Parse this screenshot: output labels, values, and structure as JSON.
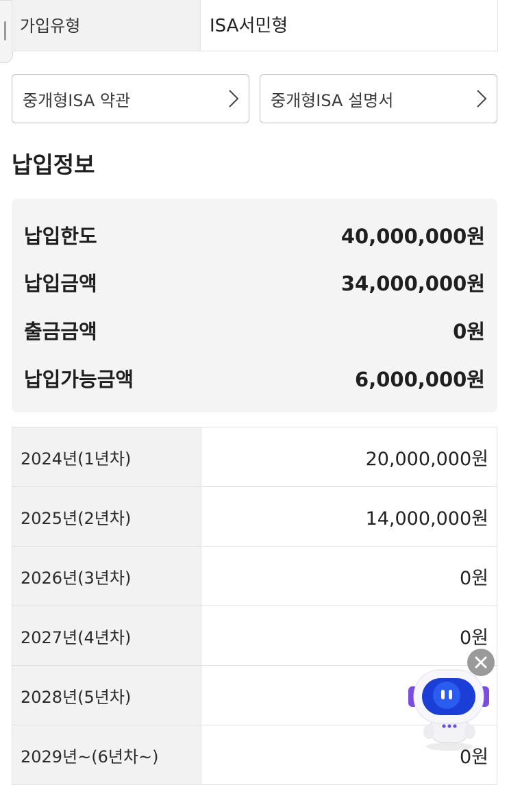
{
  "join_type": {
    "label": "가입유형",
    "value": "ISA서민형"
  },
  "docs": [
    {
      "label": "중개형ISA 약관"
    },
    {
      "label": "중개형ISA 설명서"
    }
  ],
  "payment_section_title": "납입정보",
  "summary": [
    {
      "label": "납입한도",
      "value": "40,000,000원"
    },
    {
      "label": "납입금액",
      "value": "34,000,000원"
    },
    {
      "label": "출금금액",
      "value": "0원"
    },
    {
      "label": "납입가능금액",
      "value": "6,000,000원"
    }
  ],
  "yearly": [
    {
      "year": "2024년(1년차)",
      "amount": "20,000,000원"
    },
    {
      "year": "2025년(2년차)",
      "amount": "14,000,000원"
    },
    {
      "year": "2026년(3년차)",
      "amount": "0원"
    },
    {
      "year": "2027년(4년차)",
      "amount": "0원"
    },
    {
      "year": "2028년(5년차)",
      "amount": ""
    },
    {
      "year": "2029년~(6년차~)",
      "amount": "0원"
    }
  ],
  "icons": {
    "chevron": "chevron-right-icon",
    "close": "close-icon",
    "chatbot": "robot-chatbot-icon"
  },
  "colors": {
    "robot_visor": "#1b3fd6",
    "robot_accent": "#7b4ce0"
  }
}
